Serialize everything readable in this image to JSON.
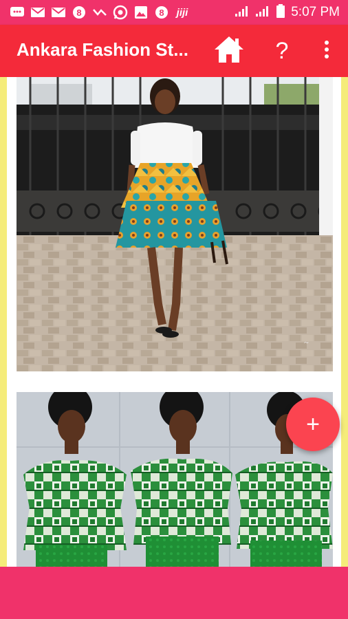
{
  "status_bar": {
    "time": "5:07 PM",
    "icons": [
      "chat-bubble-icon",
      "mail-icon",
      "mail-icon",
      "opera-icon",
      "check-icon",
      "whatsapp-icon",
      "image-icon",
      "opera-icon",
      "jiji-icon",
      "signal-icon",
      "signal-icon",
      "battery-icon"
    ],
    "jiji_text": "jiji"
  },
  "app_bar": {
    "title": "Ankara Fashion St...",
    "help_label": "?"
  },
  "fab": {
    "label": "+"
  },
  "colors": {
    "status_bar": "#f0326a",
    "app_bar": "#f42a3a",
    "content_background": "#f5ec7a",
    "fab": "#fb4450",
    "bottom_bar": "#f0326a"
  },
  "gallery": [
    {
      "image": "woman in white top and ankara peplum skirt in front of black gate"
    },
    {
      "image": "three women in green and white ankara peplum dresses"
    }
  ]
}
